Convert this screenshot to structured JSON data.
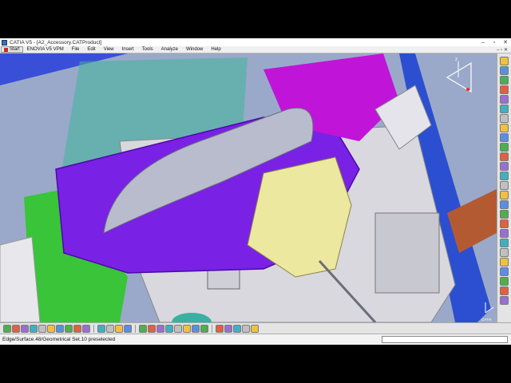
{
  "window": {
    "title": "CATIA V5 - [A2_Accessory.CATProduct]",
    "controls": [
      "–",
      "▫",
      "✕"
    ]
  },
  "menu": {
    "start": "Start",
    "items": [
      "ENOVIA V5 VPM",
      "File",
      "Edit",
      "View",
      "Insert",
      "Tools",
      "Analyze",
      "Window",
      "Help"
    ],
    "doc_controls": "– ▫ ✕"
  },
  "status": {
    "text": "Edge/Surface.48/Geometrical Set.10 preselected",
    "command_input": ""
  },
  "compass": {
    "label": "z"
  },
  "logo": {
    "text": "CATIA"
  },
  "colors": {
    "viewport_bg": "#9aa9c9",
    "purple_part": "#7a21e6",
    "magenta_part": "#c014d8",
    "green_part": "#39c43a",
    "teal_part": "#4cb6a0",
    "yellow_part": "#ece8a0",
    "grey_part": "#d8d8de",
    "blue_frame": "#2b4fd0"
  },
  "icons": {
    "right_toolbar": [
      "select-icon",
      "zoom-icon",
      "pan-icon",
      "rotate-icon",
      "fit-icon",
      "sketch-icon",
      "pad-icon",
      "pocket-icon",
      "shaft-icon",
      "groove-icon",
      "hole-icon",
      "rib-icon",
      "slot-icon",
      "fillet-icon",
      "chamfer-icon",
      "draft-icon",
      "shell-icon",
      "thickness-icon",
      "thread-icon",
      "remove-icon",
      "replace-icon",
      "measure-icon",
      "measure-item-icon",
      "analysis-icon",
      "light-icon",
      "material-icon"
    ],
    "bottom_toolbar": [
      "new-icon",
      "open-icon",
      "save-icon",
      "print-icon",
      "cut-icon",
      "copy-icon",
      "paste-icon",
      "undo-icon",
      "redo-icon",
      "whats-this-icon",
      "formula-icon",
      "comment-icon",
      "catalog-icon",
      "product-icon",
      "component-icon",
      "fly-icon",
      "fit-all-icon",
      "pan-view-icon",
      "rotate-view-icon",
      "zoom-in-icon",
      "zoom-out-icon",
      "normal-view-icon",
      "iso-view-icon",
      "shading-icon",
      "hide-show-icon",
      "swap-space-icon",
      "sectioning-icon"
    ]
  }
}
